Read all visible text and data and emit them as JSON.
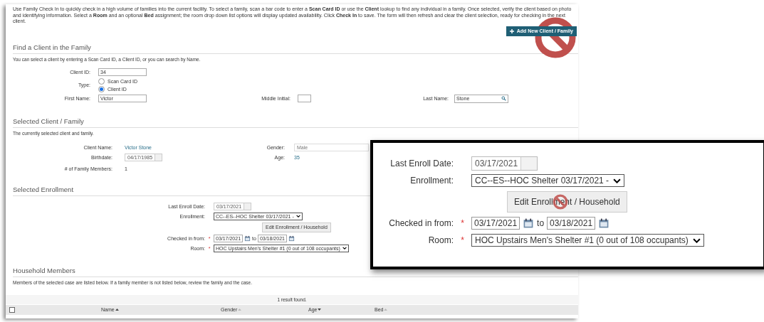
{
  "intro": "Use Family Check In to quickly check in a high volume of families into the current facility. To select a family, scan a bar code to enter a **Scan Card ID** or use the **Client** lookup to find any individual in a family. Once selected, verify the client based on photo and identifying information. Select a **Room** and an optional **Bed** assignment; the room drop down list options will display updated availability. Click **Check In** to save. The form will then refresh and clear the client selection, ready for checking in the next client.",
  "add_button": {
    "label": "Add New Client / Family"
  },
  "find": {
    "title": "Find a Client in the Family",
    "help": "You can select a client by entering a Scan Card ID, a Client ID, or you can search by Name.",
    "client_id": {
      "label": "Client ID:",
      "value": "34"
    },
    "type": {
      "label": "Type:",
      "options": [
        {
          "label": "Scan Card ID",
          "selected": false
        },
        {
          "label": "Client ID",
          "selected": true
        }
      ]
    },
    "first_name": {
      "label": "First Name:",
      "value": "Victor"
    },
    "middle_initial": {
      "label": "Middle Initial:"
    },
    "last_name": {
      "label": "Last Name:",
      "value": "Stone"
    }
  },
  "client": {
    "title": "Selected Client / Family",
    "help": "The currently selected client and family.",
    "name": {
      "label": "Client Name:",
      "value": "Victor Stone"
    },
    "birthdate": {
      "label": "Birthdate:",
      "value": "04/17/1985"
    },
    "members": {
      "label": "# of Family Members:",
      "value": "1"
    },
    "gender": {
      "label": "Gender:",
      "value": "Male"
    },
    "age": {
      "label": "Age:",
      "value": "35"
    }
  },
  "enrollment": {
    "title": "Selected Enrollment",
    "last_enroll_date": {
      "label": "Last Enroll Date:",
      "value": "03/17/2021"
    },
    "enrollment": {
      "label": "Enrollment:",
      "value": "CC--ES--HOC Shelter 03/17/2021 -"
    },
    "edit_button": {
      "label": "Edit Enrollment / Household"
    },
    "checked_in": {
      "label": "Checked in from:",
      "required_mark": "*",
      "from": "03/17/2021",
      "to_label": "to",
      "to": "03/18/2021"
    },
    "room": {
      "label": "Room:",
      "required_mark": "*",
      "value": "HOC Upstairs Men's Shelter #1 (0 out of 108 occupants)"
    }
  },
  "household": {
    "title": "Household Members",
    "help": "Members of the selected case are listed below. If a family member is not listed below, review the family and the case.",
    "result": "1 result found.",
    "select_all": {
      "checked": false
    },
    "columns": [
      {
        "label": "Name",
        "sorted": true,
        "descending": false
      },
      {
        "label": "Gender",
        "sorted": false,
        "descending": false
      },
      {
        "label": "Age",
        "sorted": true,
        "descending": true
      },
      {
        "label": "Bed",
        "sorted": false,
        "descending": false
      }
    ]
  },
  "callout": {
    "last_enroll_date": {
      "label": "Last Enroll Date:",
      "value": "03/17/2021"
    },
    "enrollment": {
      "label": "Enrollment:",
      "value": "CC--ES--HOC Shelter 03/17/2021 -"
    },
    "edit_button": {
      "label": "Edit Enrollment / Household"
    },
    "checked_in": {
      "label": "Checked in from:",
      "required_mark": "*",
      "from": "03/17/2021",
      "to_label": "to",
      "to": "03/18/2021"
    },
    "room": {
      "label": "Room:",
      "required_mark": "*",
      "value": "HOC Upstairs Men's Shelter #1 (0 out of 108 occupants)"
    }
  }
}
